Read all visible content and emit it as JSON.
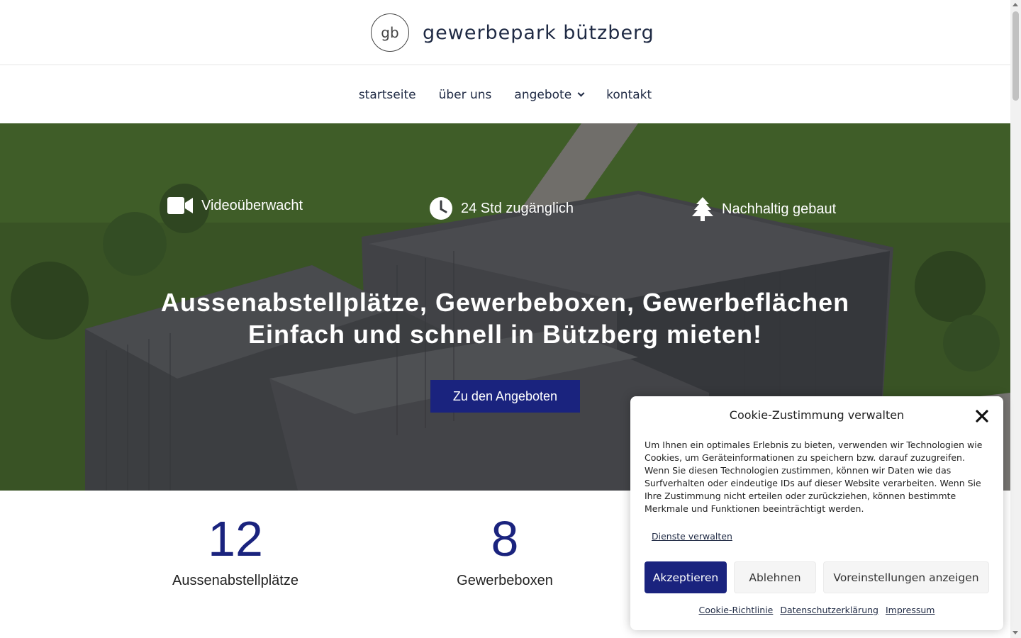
{
  "header": {
    "logo_text": "gb",
    "site_name": "gewerbepark bützberg"
  },
  "nav": {
    "items": [
      {
        "label": "startseite"
      },
      {
        "label": "über uns"
      },
      {
        "label": "angebote"
      },
      {
        "label": "kontakt"
      }
    ]
  },
  "hero": {
    "features": [
      {
        "icon": "video-camera-icon",
        "label": "Videoüberwacht"
      },
      {
        "icon": "clock-icon",
        "label": "24 Std zugänglich"
      },
      {
        "icon": "tree-icon",
        "label": "Nachhaltig gebaut"
      }
    ],
    "headline_line1": "Aussenabstellplätze, Gewerbeboxen, Gewerbeflächen",
    "headline_line2": "Einfach und schnell in Bützberg mieten!",
    "cta_label": "Zu den Angeboten"
  },
  "counters": [
    {
      "value": "12",
      "label": "Aussenabstellplätze"
    },
    {
      "value": "8",
      "label": "Gewerbeboxen"
    }
  ],
  "cookie": {
    "title": "Cookie-Zustimmung verwalten",
    "body": "Um Ihnen ein optimales Erlebnis zu bieten, verwenden wir Technologien wie Cookies, um Geräteinformationen zu speichern bzw. darauf zuzugreifen. Wenn Sie diesen Technologien zustimmen, können wir Daten wie das Surfverhalten oder eindeutige IDs auf dieser Website verarbeiten. Wenn Sie Ihre Zustimmung nicht erteilen oder zurückziehen, können bestimmte Merkmale und Funktionen beeinträchtigt werden.",
    "manage_label": "Dienste verwalten",
    "accept_label": "Akzeptieren",
    "deny_label": "Ablehnen",
    "prefs_label": "Voreinstellungen anzeigen",
    "links": [
      {
        "label": "Cookie-Richtlinie"
      },
      {
        "label": "Datenschutzerklärung"
      },
      {
        "label": "Impressum"
      }
    ]
  },
  "colors": {
    "brand_navy": "#1a237e",
    "text_dark": "#1f2a44"
  }
}
